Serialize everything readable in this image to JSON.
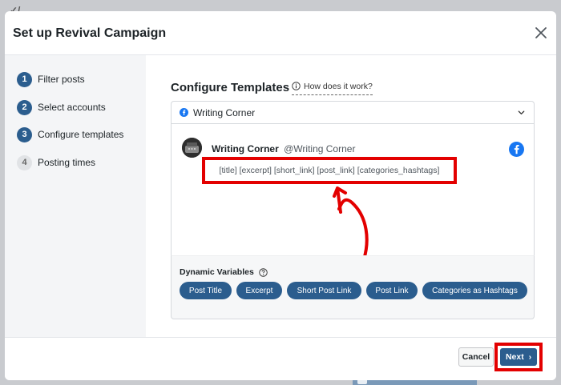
{
  "modal": {
    "title": "Set up Revival Campaign"
  },
  "steps": [
    {
      "num": "1",
      "label": "Filter posts",
      "state": "done"
    },
    {
      "num": "2",
      "label": "Select accounts",
      "state": "done"
    },
    {
      "num": "3",
      "label": "Configure templates",
      "state": "active"
    },
    {
      "num": "4",
      "label": "Posting times",
      "state": "inactive"
    }
  ],
  "main": {
    "title": "Configure Templates",
    "help_link": "How does it work?"
  },
  "account": {
    "name": "Writing Corner",
    "network_icon": "facebook-icon"
  },
  "preview": {
    "author_name": "Writing Corner",
    "author_handle": "@Writing Corner",
    "template": "[title] [excerpt] [short_link] [post_link] [categories_hashtags]"
  },
  "variables": {
    "title": "Dynamic Variables",
    "chips": [
      "Post Title",
      "Excerpt",
      "Short Post Link",
      "Post Link",
      "Categories as Hashtags"
    ]
  },
  "footer": {
    "cancel_label": "Cancel",
    "next_label": "Next"
  },
  "colors": {
    "primary": "#2b5d8e",
    "highlight": "#e30000",
    "facebook": "#1877f2"
  }
}
